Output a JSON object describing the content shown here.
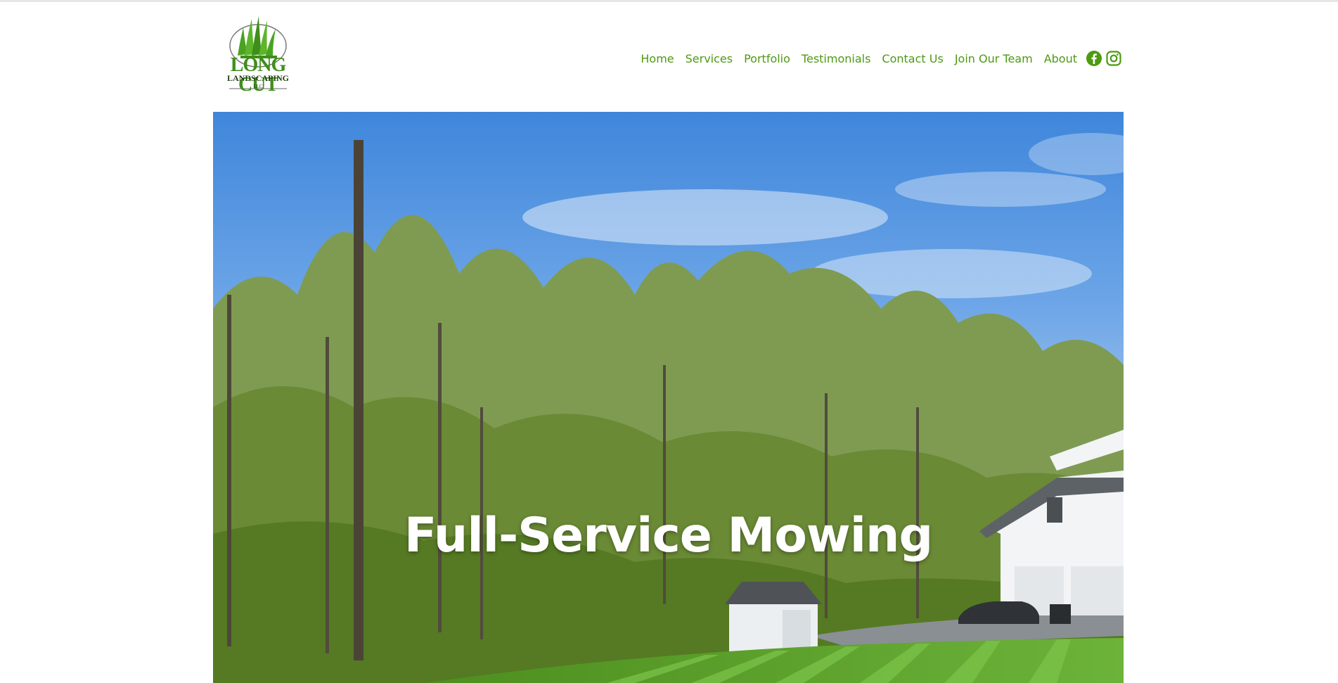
{
  "header": {
    "logo": {
      "name_line1": "LONG CUT",
      "name_line2": "LANDSCAPING",
      "suffix": "LLC"
    },
    "nav": [
      {
        "label": "Home"
      },
      {
        "label": "Services"
      },
      {
        "label": "Portfolio"
      },
      {
        "label": "Testimonials"
      },
      {
        "label": "Contact Us"
      },
      {
        "label": "Join Our Team"
      },
      {
        "label": "About"
      }
    ],
    "social": [
      "facebook-icon",
      "instagram-icon"
    ]
  },
  "hero": {
    "title": "Full-Service Mowing"
  },
  "colors": {
    "brand_green": "#4e9a12",
    "sky_blue": "#4a8fe0"
  }
}
